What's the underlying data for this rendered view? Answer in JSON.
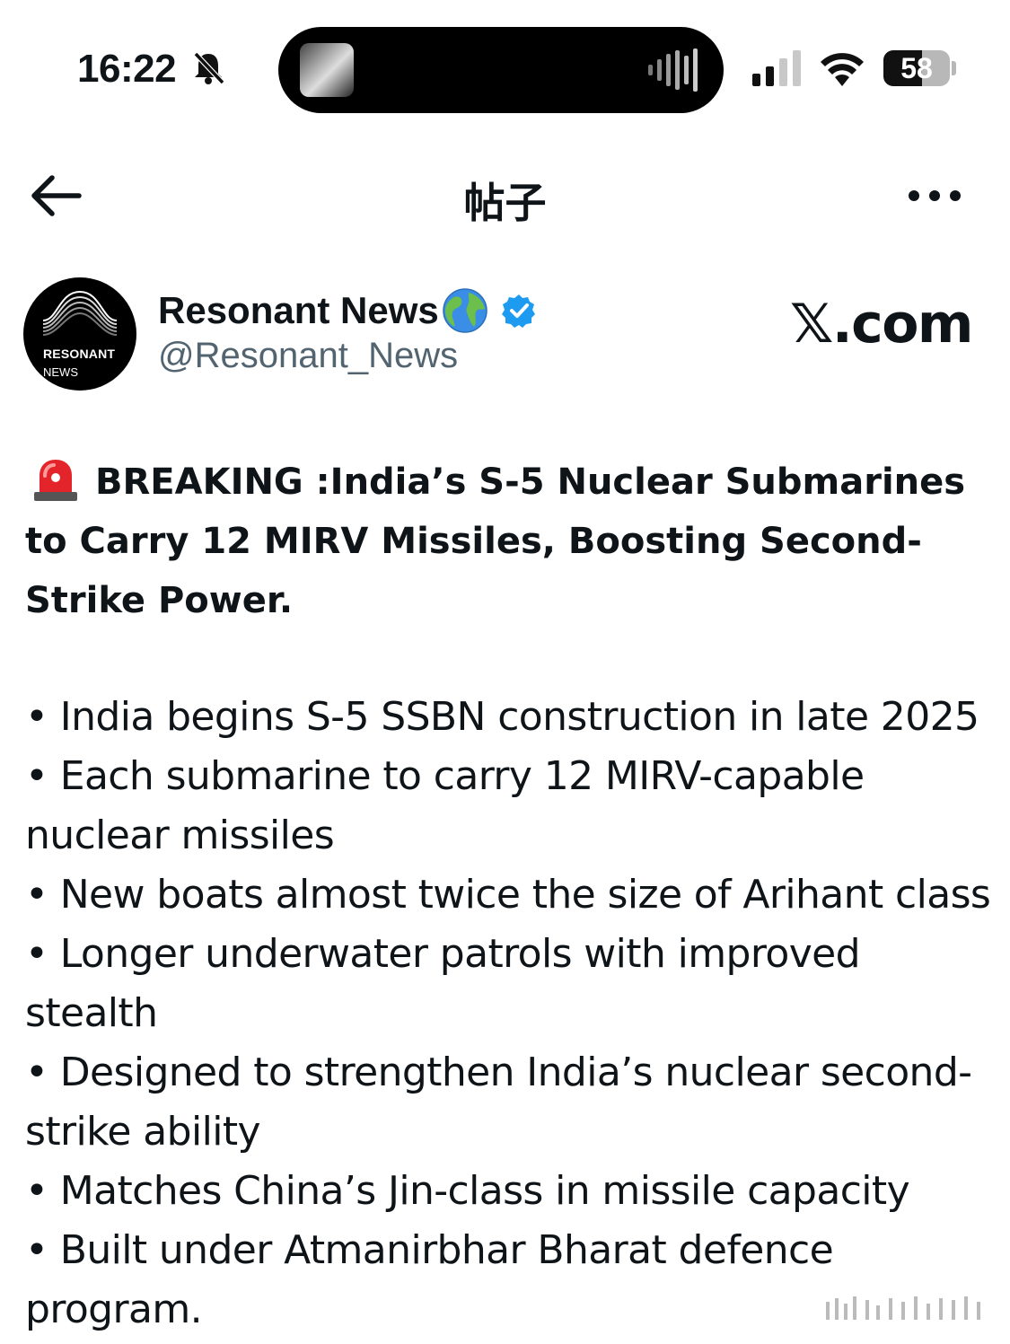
{
  "status_bar": {
    "time": "16:22",
    "battery": "58",
    "battery_level_percent": 58,
    "icons": [
      "bell-muted-icon",
      "signal-icon",
      "wifi-icon",
      "battery-icon"
    ]
  },
  "nav": {
    "title": "帖子",
    "icons": [
      "back-arrow-icon",
      "more-icon"
    ]
  },
  "post": {
    "author": {
      "display_name": "Resonant News",
      "handle": "@Resonant_News",
      "avatar_line1": "RESONANT",
      "avatar_line2": "NEWS",
      "verified_color": "#1d9bf0"
    },
    "brand": "𝕏.com",
    "headline": "BREAKING :India’s S-5 Nuclear Submarines to Carry 12 MIRV Missiles, Boosting Second-Strike Power.",
    "bullets": [
      "• India begins S-5 SSBN construction in late 2025",
      "• Each submarine to carry 12 MIRV-capable nuclear missiles",
      "• New boats almost twice the size of Arihant class",
      "• Longer underwater patrols with improved stealth",
      "• Designed to strengthen India’s nuclear second-strike ability",
      "• Matches China’s Jin-class in missile capacity",
      "• Built under Atmanirbhar Bharat defence program."
    ]
  }
}
